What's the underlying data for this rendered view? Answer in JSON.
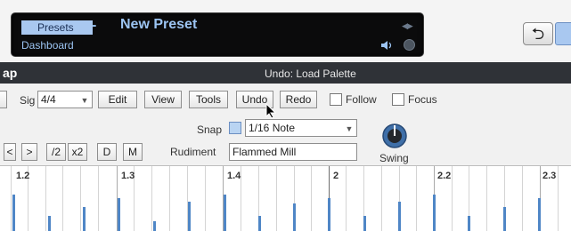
{
  "header": {
    "presets_tag": "Presets",
    "separator": "-",
    "preset_name": "New Preset",
    "dashboard": "Dashboard"
  },
  "titlebar": {
    "left": "ap",
    "center": "Undo: Load Palette"
  },
  "toolbar": {
    "sig_label": "Sig",
    "sig_value": "4/4",
    "edit": "Edit",
    "view": "View",
    "tools": "Tools",
    "undo": "Undo",
    "redo": "Redo",
    "follow": "Follow",
    "focus": "Focus"
  },
  "snap": {
    "label": "Snap",
    "value": "1/16 Note",
    "checked": true
  },
  "rudiment": {
    "label": "Rudiment",
    "value": "Flammed Mill"
  },
  "swing": {
    "label": "Swing"
  },
  "transport": {
    "prev": "<",
    "next": ">",
    "half": "/2",
    "double": "x2",
    "d": "D",
    "m": "M"
  },
  "ruler": {
    "labels": [
      "1.2",
      "1.3",
      "1.4",
      "2",
      "2.2",
      "2.3"
    ]
  },
  "colors": {
    "accent": "#a9c8f0",
    "hit": "#4f86c6",
    "titlebar": "#2f3237"
  }
}
